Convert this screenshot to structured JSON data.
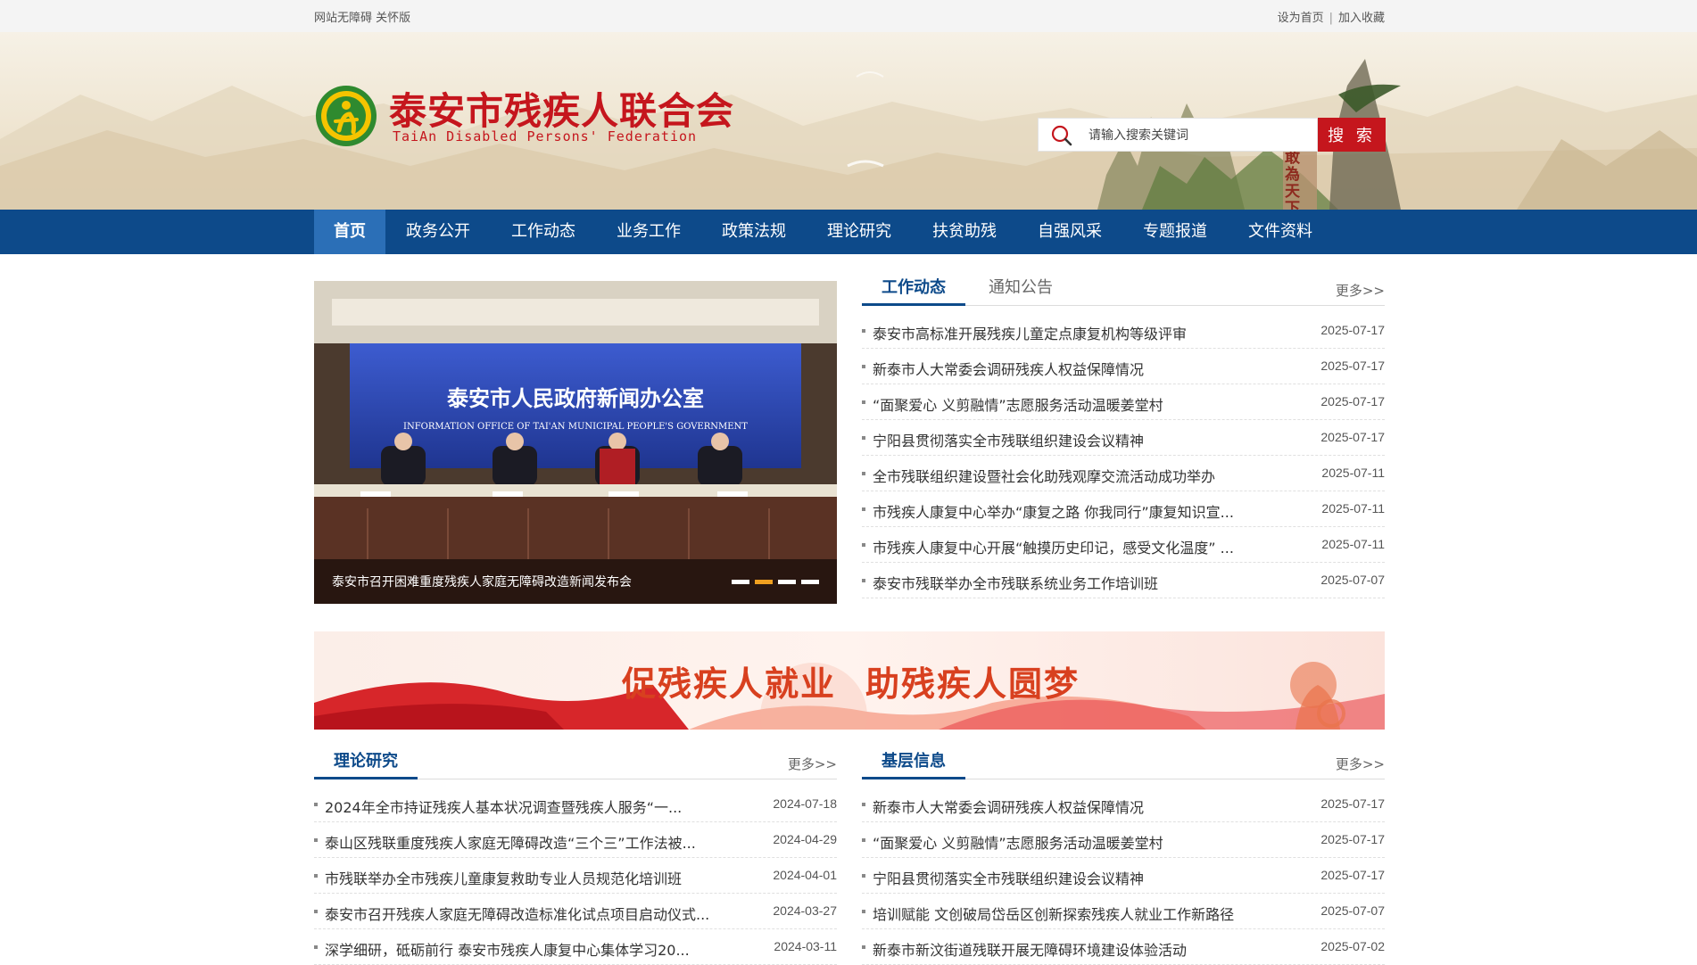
{
  "topbar": {
    "accessibility": "网站无障碍",
    "care_mode": "关怀版",
    "set_home": "设为首页",
    "add_favorite": "加入收藏"
  },
  "header": {
    "title": "泰安市残疾人联合会",
    "subtitle": "TaiAn Disabled Persons' Federation",
    "search_placeholder": "请输入搜索关键词",
    "search_button": "搜 索",
    "seal_text": "敢為天下先"
  },
  "nav": {
    "items": [
      "首页",
      "政务公开",
      "工作动态",
      "业务工作",
      "政策法规",
      "理论研究",
      "扶贫助残",
      "自强风采",
      "专题报道",
      "文件资料"
    ]
  },
  "slider": {
    "caption": "泰安市召开困难重度残疾人家庭无障碍改造新闻发布会",
    "photo_title": "泰安市人民政府新闻办公室",
    "photo_subtitle": "INFORMATION OFFICE OF TAI'AN MUNICIPAL PEOPLE'S GOVERNMENT"
  },
  "news": {
    "tabs": [
      "工作动态",
      "通知公告"
    ],
    "more": "更多>>",
    "items": [
      {
        "title": "泰安市高标准开展残疾儿童定点康复机构等级评审",
        "date": "2025-07-17"
      },
      {
        "title": "新泰市人大常委会调研残疾人权益保障情况",
        "date": "2025-07-17"
      },
      {
        "title": "“面聚爱心 义剪融情”志愿服务活动温暖姜堂村",
        "date": "2025-07-17"
      },
      {
        "title": "宁阳县贯彻落实全市残联组织建设会议精神",
        "date": "2025-07-17"
      },
      {
        "title": "全市残联组织建设暨社会化助残观摩交流活动成功举办",
        "date": "2025-07-11"
      },
      {
        "title": "市残疾人康复中心举办“康复之路 你我同行”康复知识宣...",
        "date": "2025-07-11"
      },
      {
        "title": "市残疾人康复中心开展“触摸历史印记，感受文化温度” ...",
        "date": "2025-07-11"
      },
      {
        "title": "泰安市残联举办全市残联系统业务工作培训班",
        "date": "2025-07-07"
      }
    ]
  },
  "banner": {
    "slogan_left": "促残疾人就业",
    "slogan_right": "助残疾人圆梦"
  },
  "theory": {
    "title": "理论研究",
    "more": "更多>>",
    "items": [
      {
        "title": "2024年全市持证残疾人基本状况调查暨残疾人服务“一...",
        "date": "2024-07-18"
      },
      {
        "title": "泰山区残联重度残疾人家庭无障碍改造“三个三”工作法被...",
        "date": "2024-04-29"
      },
      {
        "title": "市残联举办全市残疾儿童康复救助专业人员规范化培训班",
        "date": "2024-04-01"
      },
      {
        "title": "泰安市召开残疾人家庭无障碍改造标准化试点项目启动仪式...",
        "date": "2024-03-27"
      },
      {
        "title": "深学细研，砥砺前行 泰安市残疾人康复中心集体学习20...",
        "date": "2024-03-11"
      }
    ]
  },
  "grassroots": {
    "title": "基层信息",
    "more": "更多>>",
    "items": [
      {
        "title": "新泰市人大常委会调研残疾人权益保障情况",
        "date": "2025-07-17"
      },
      {
        "title": "“面聚爱心 义剪融情”志愿服务活动温暖姜堂村",
        "date": "2025-07-17"
      },
      {
        "title": "宁阳县贯彻落实全市残联组织建设会议精神",
        "date": "2025-07-17"
      },
      {
        "title": "培训赋能 文创破局岱岳区创新探索残疾人就业工作新路径",
        "date": "2025-07-07"
      },
      {
        "title": "新泰市新汶街道残联开展无障碍环境建设体验活动",
        "date": "2025-07-02"
      }
    ]
  }
}
